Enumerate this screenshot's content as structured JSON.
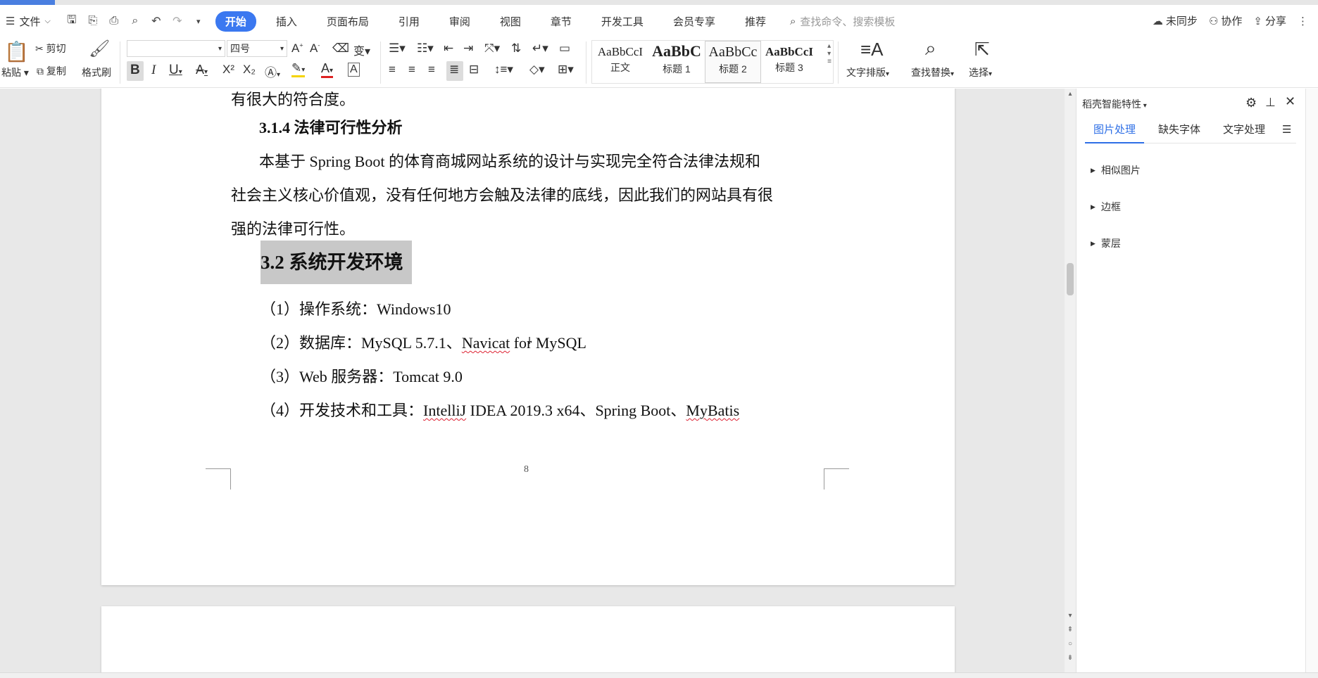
{
  "menu": {
    "file_label": "文件",
    "tabs": [
      "开始",
      "插入",
      "页面布局",
      "引用",
      "审阅",
      "视图",
      "章节",
      "开发工具",
      "会员专享",
      "推荐"
    ],
    "search_placeholder": "查找命令、搜索模板",
    "not_synced": "未同步",
    "collaborate": "协作",
    "share": "分享"
  },
  "ribbon": {
    "paste": "粘贴",
    "cut": "剪切",
    "copy": "复制",
    "format_painter": "格式刷",
    "font_size": "四号",
    "styles": [
      {
        "preview": "AaBbCcI",
        "name": "正文"
      },
      {
        "preview": "AaBbC",
        "name": "标题 1"
      },
      {
        "preview": "AaBbCc",
        "name": "标题 2"
      },
      {
        "preview": "AaBbCcI",
        "name": "标题 3"
      }
    ],
    "text_layout": "文字排版",
    "find_replace": "查找替换",
    "select": "选择"
  },
  "document": {
    "line_top": "有很大的符合度。",
    "h314": "3.1.4    法律可行性分析",
    "para1": "本基于 Spring Boot 的体育商城网站系统的设计与实现完全符合法律法规和",
    "para2": "社会主义核心价值观，没有任何地方会触及法律的底线，因此我们的网站具有很",
    "para3": "强的法律可行性。",
    "h32": "3.2    系统开发环境",
    "item1": "（1）操作系统：Windows10",
    "item2a": "（2）数据库：MySQL 5.7.1、",
    "item2b": "Navicat",
    "item2c": " for MySQL",
    "item3": "（3）Web 服务器：Tomcat 9.0",
    "item4a": "（4）开发技术和工具：",
    "item4b": "IntelliJ",
    "item4c": " IDEA 2019.3 x64、Spring Boot、",
    "item4d": "MyBatis",
    "page_number": "8"
  },
  "panel": {
    "title": "稻壳智能特性",
    "tabs": [
      "图片处理",
      "缺失字体",
      "文字处理"
    ],
    "sections": [
      "相似图片",
      "边框",
      "蒙层"
    ]
  }
}
